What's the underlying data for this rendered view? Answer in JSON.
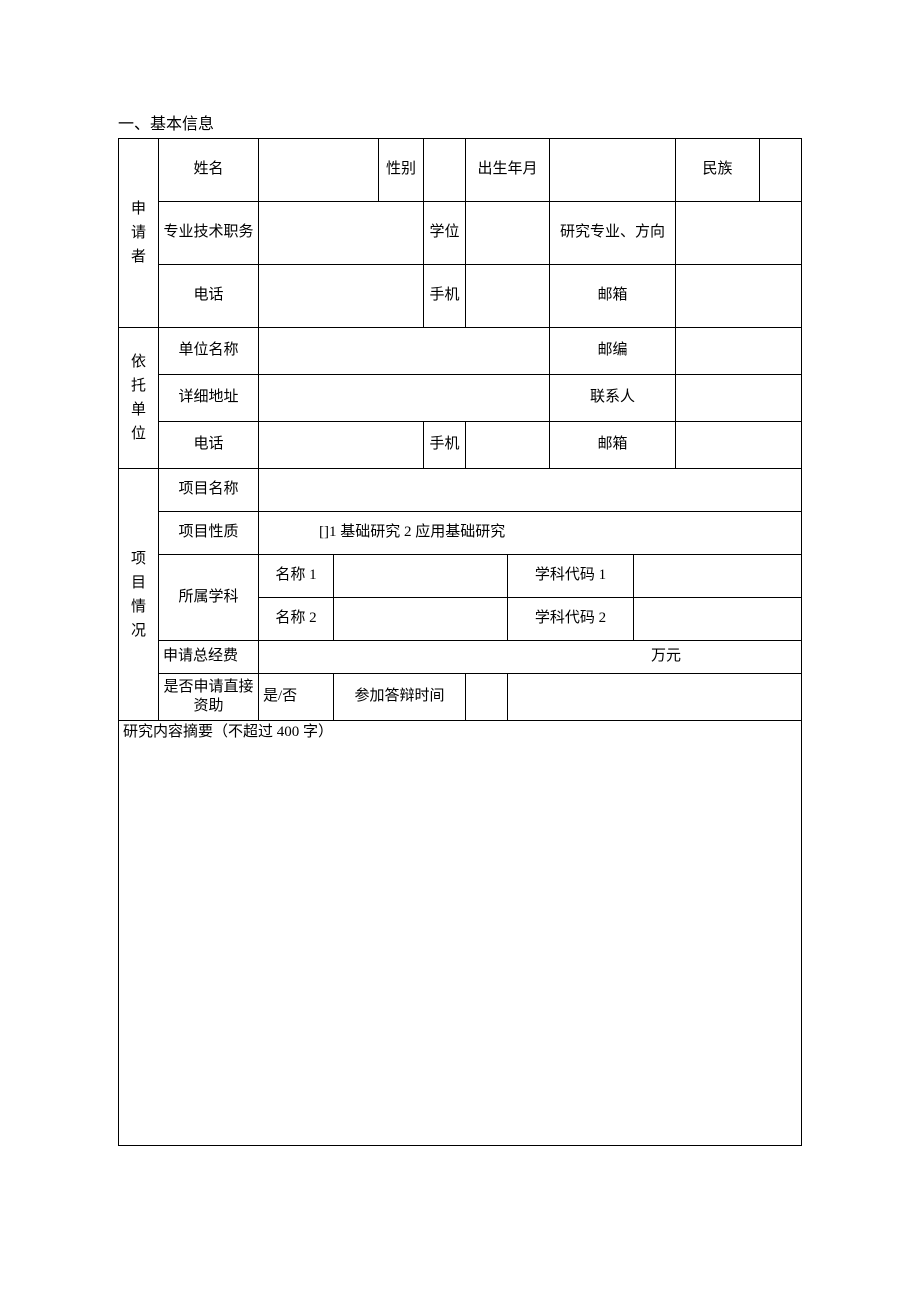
{
  "section_title": "一、基本信息",
  "applicant": {
    "header": "申\n请\n者",
    "name_label": "姓名",
    "name_value": "",
    "gender_label": "性别",
    "gender_value": "",
    "dob_label": "出生年月",
    "dob_value": "",
    "ethnicity_label": "民族",
    "ethnicity_value": "",
    "protitle_label": "专业技术职务",
    "protitle_value": "",
    "degree_label": "学位",
    "degree_value": "",
    "research_dir_label": "研究专业、方向",
    "research_dir_value": "",
    "phone_label": "电话",
    "phone_value": "",
    "mobile_label": "手机",
    "mobile_value": "",
    "email_label": "邮箱",
    "email_value": ""
  },
  "org": {
    "header": "依\n托\n单\n位",
    "name_label": "单位名称",
    "name_value": "",
    "zip_label": "邮编",
    "zip_value": "",
    "addr_label": "详细地址",
    "addr_value": "",
    "contact_label": "联系人",
    "contact_value": "",
    "phone_label": "电话",
    "phone_value": "",
    "mobile_label": "手机",
    "mobile_value": "",
    "email_label": "邮箱",
    "email_value": ""
  },
  "project": {
    "header": "项\n目\n情\n况",
    "name_label": "项目名称",
    "name_value": "",
    "nature_label": "项目性质",
    "nature_value": "[]1 基础研究           2 应用基础研究",
    "discipline_label": "所属学科",
    "disc_name1_label": "名称 1",
    "disc_name1_value": "",
    "disc_code1_label": "学科代码 1",
    "disc_code1_value": "",
    "disc_name2_label": "名称 2",
    "disc_name2_value": "",
    "disc_code2_label": "学科代码 2",
    "disc_code2_value": "",
    "fund_label": "申请总经费",
    "fund_unit": "万元",
    "direct_fund_label": "是否申请直接资助",
    "direct_fund_value": "是/否",
    "defense_time_label": "参加答辩时间",
    "defense_time_value1": "",
    "defense_time_value2": ""
  },
  "abstract": {
    "label": "研究内容摘要（不超过 400 字）",
    "value": ""
  }
}
